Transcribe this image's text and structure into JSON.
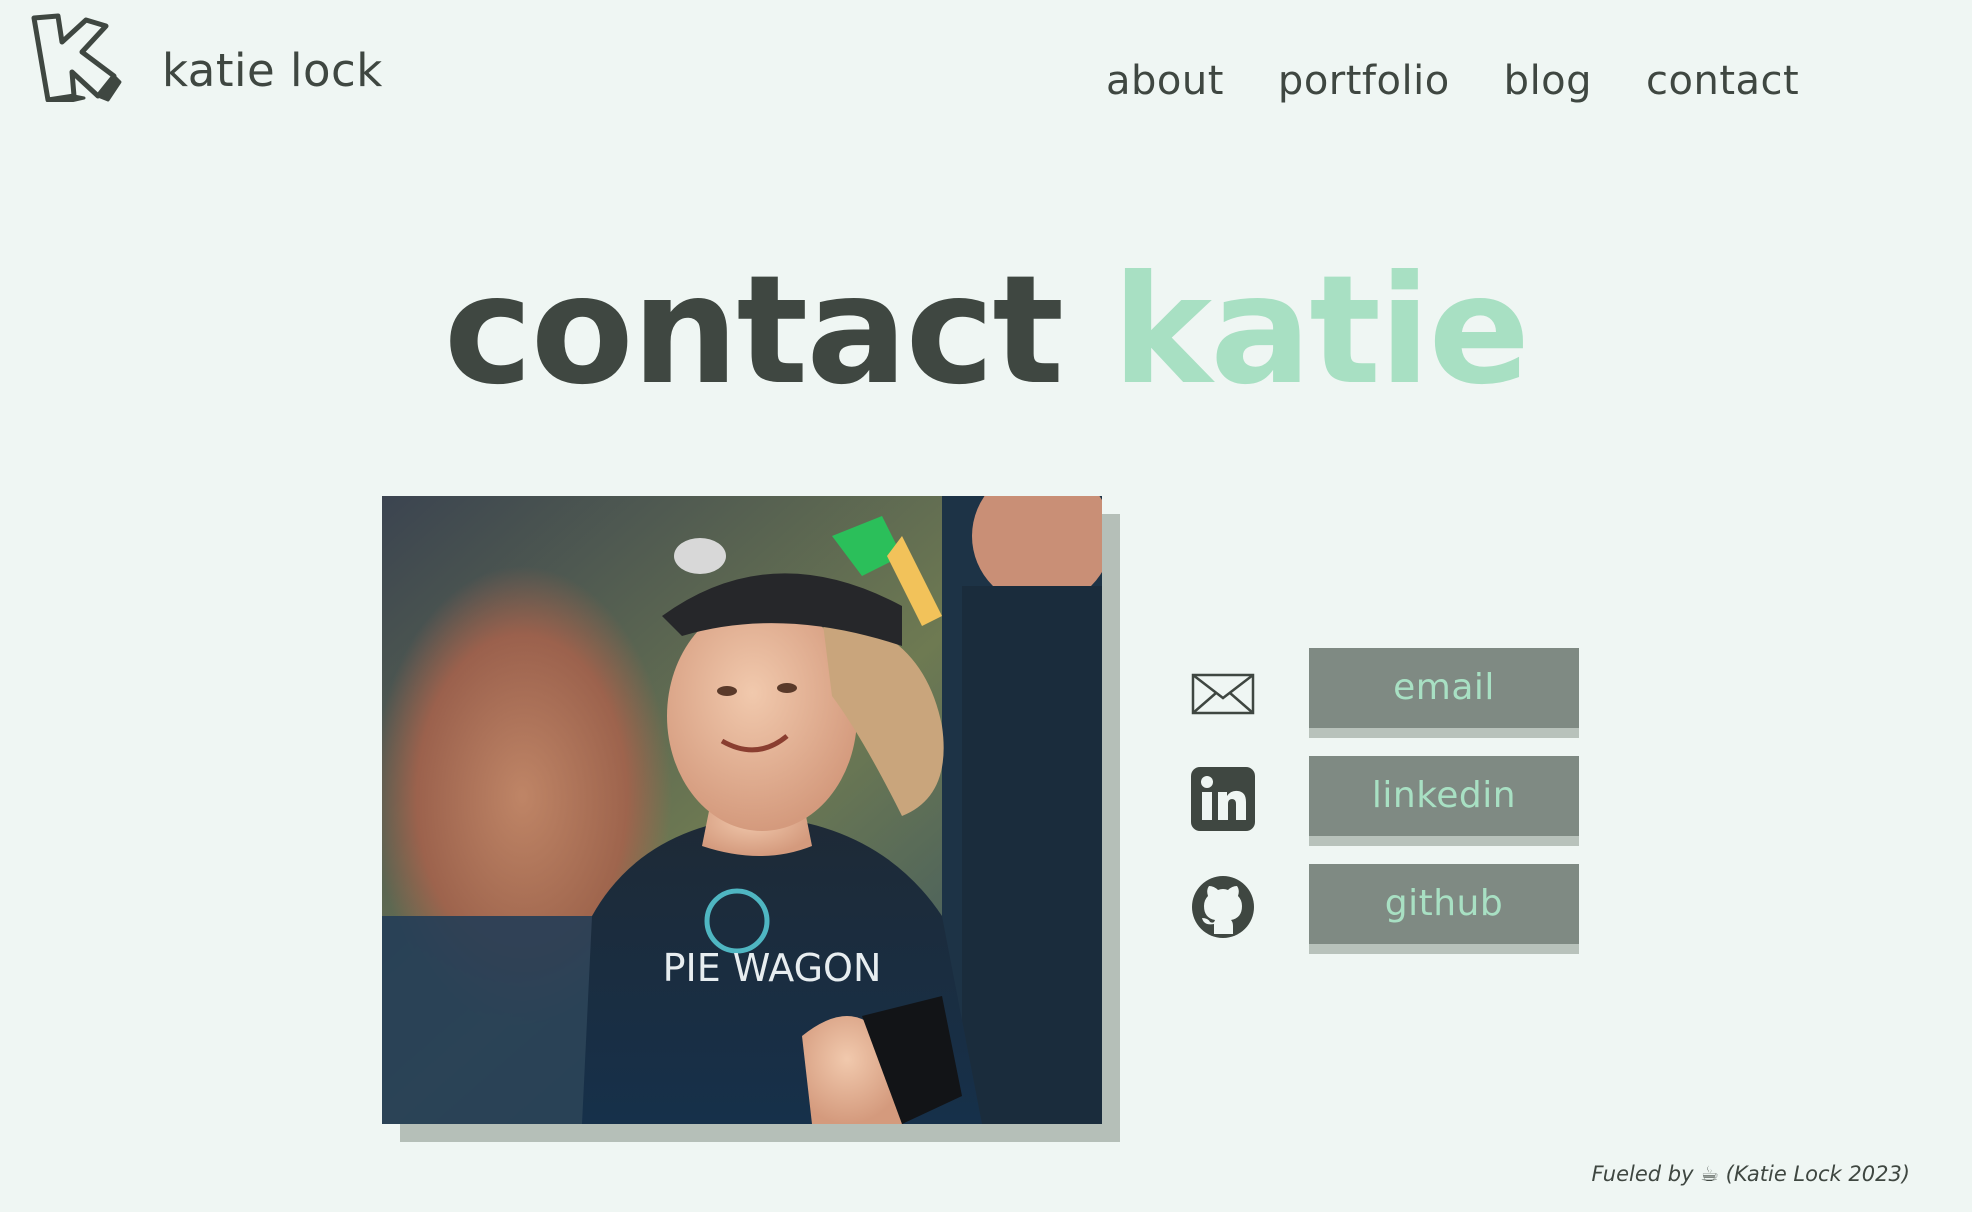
{
  "site": {
    "name": "katie lock",
    "logo_icon": "k-logo-icon"
  },
  "nav": {
    "items": [
      {
        "label": "about"
      },
      {
        "label": "portfolio"
      },
      {
        "label": "blog"
      },
      {
        "label": "contact"
      }
    ]
  },
  "hero": {
    "word1": "contact",
    "word2": "katie"
  },
  "photo": {
    "jersey_text": "PIE WAGON"
  },
  "contacts": [
    {
      "icon": "envelope-icon",
      "label": "email"
    },
    {
      "icon": "linkedin-icon",
      "label": "linkedin"
    },
    {
      "icon": "github-icon",
      "label": "github"
    }
  ],
  "footer": {
    "text": "Fueled by ☕ (Katie Lock 2023)"
  },
  "colors": {
    "background": "#eff6f3",
    "text_dark": "#3f4741",
    "accent_mint": "#a8e0c3",
    "button_bg": "#7f8a83",
    "shadow": "#b5bfb8"
  }
}
